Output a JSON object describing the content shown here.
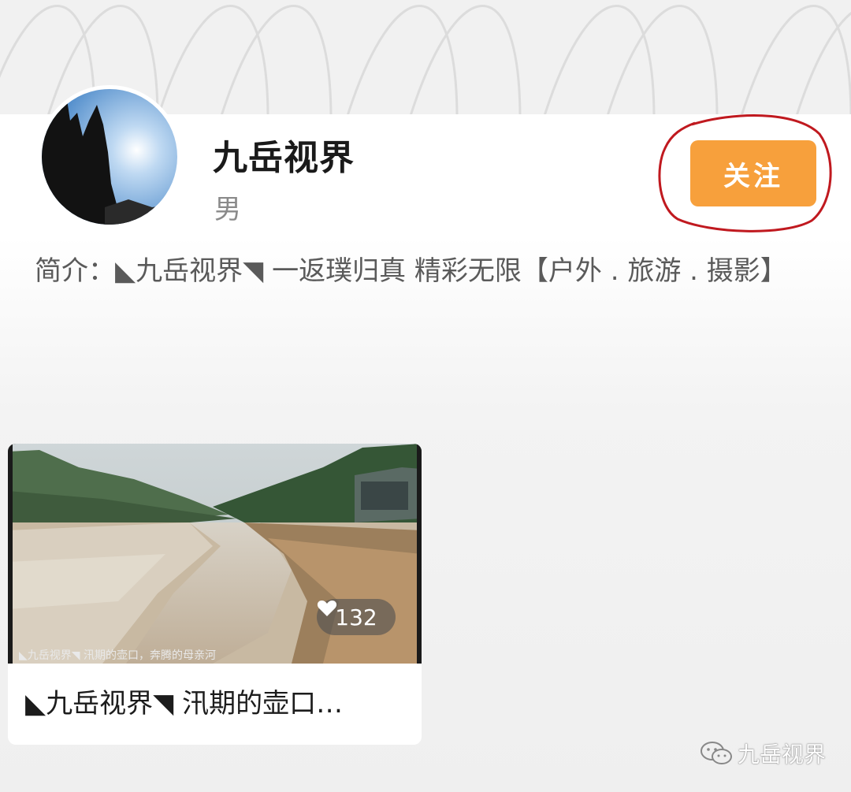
{
  "profile": {
    "nickname": "九岳视界",
    "gender": "男",
    "follow_label": "关注",
    "bio_label": "简介：",
    "bio_text": "◣九岳视界◥ 一返璞归真 精彩无限【户外 . 旅游 . 摄影】"
  },
  "posts": [
    {
      "title": "◣九岳视界◥ 汛期的壶口…",
      "thumbnail_caption": "◣九岳视界◥ 汛期的壶口，奔腾的母亲河",
      "likes": "132"
    }
  ],
  "watermark": {
    "text": "九岳视界",
    "icon": "wechat-icon"
  },
  "colors": {
    "accent": "#f7a03c",
    "annotation": "#c0191f"
  }
}
